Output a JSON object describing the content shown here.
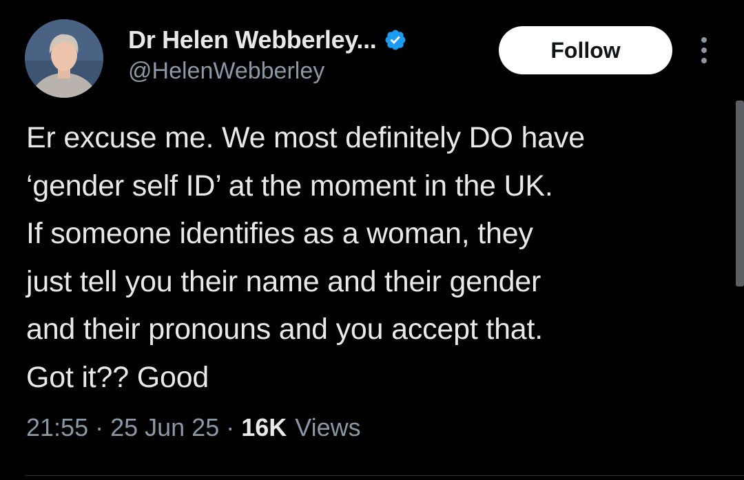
{
  "author": {
    "display_name": "Dr Helen Webberley...",
    "handle": "@HelenWebberley",
    "verified": true,
    "avatar_icon": "profile-photo"
  },
  "actions": {
    "follow_label": "Follow",
    "more_icon": "more-vertical-icon"
  },
  "tweet": {
    "text": "Er excuse me. We most definitely DO have\n‘gender self ID’ at the moment in the UK.\nIf someone identifies as a woman, they\njust tell you their name and their gender\nand their pronouns and you accept that.\nGot it?? Good",
    "time": "21:55",
    "date": "25 Jun 25",
    "views_count": "16K",
    "views_label": "Views",
    "separator": "·"
  },
  "colors": {
    "background": "#000000",
    "text_primary": "#e7e9ea",
    "text_secondary": "#8b98a5",
    "verified_badge": "#1d9bf0",
    "follow_button_bg": "#ffffff",
    "follow_button_text": "#0f1419"
  }
}
